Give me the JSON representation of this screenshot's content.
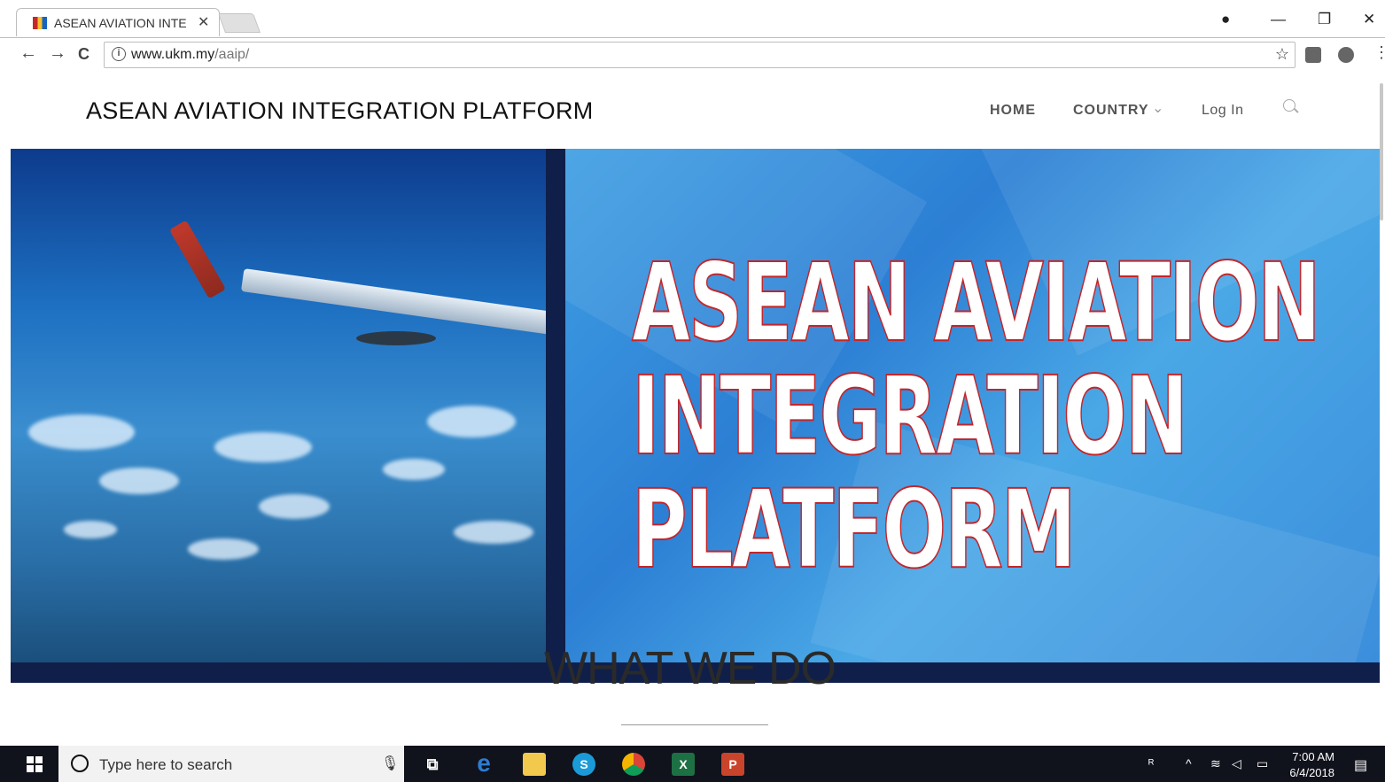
{
  "browser": {
    "tab_title": "ASEAN AVIATION INTEGR",
    "tab_close": "✕",
    "url_host": "www.ukm.my",
    "url_path": "/aaip/",
    "window_controls": {
      "profile": "●",
      "minimize": "—",
      "restore": "❐",
      "close": "✕"
    },
    "nav": {
      "back": "←",
      "forward": "→",
      "reload": "C",
      "star": "☆",
      "menu": "⋮"
    }
  },
  "site": {
    "title": "ASEAN AVIATION INTEGRATION PLATFORM",
    "nav": {
      "home": "HOME",
      "country": "COUNTRY",
      "country_caret": "⌄",
      "login": "Log In"
    }
  },
  "hero": {
    "headline": "ASEAN AVIATION\nINTEGRATION\nPLATFORM",
    "colors": {
      "navy": "#0f1f4a",
      "blue": "#3f9fe3",
      "outline_red": "#c2262b"
    }
  },
  "section": {
    "heading": "WHAT WE DO"
  },
  "taskbar": {
    "search_placeholder": "Type here to search",
    "time": "7:00 AM",
    "date": "6/4/2018",
    "apps": [
      {
        "icon": "task-view-icon",
        "label": "⧉"
      },
      {
        "icon": "edge-icon",
        "label": "e"
      },
      {
        "icon": "file-explorer-icon",
        "label": ""
      },
      {
        "icon": "skype-icon",
        "label": "S"
      },
      {
        "icon": "chrome-icon",
        "label": ""
      },
      {
        "icon": "excel-icon",
        "label": "X"
      },
      {
        "icon": "powerpoint-icon",
        "label": "P"
      }
    ]
  }
}
